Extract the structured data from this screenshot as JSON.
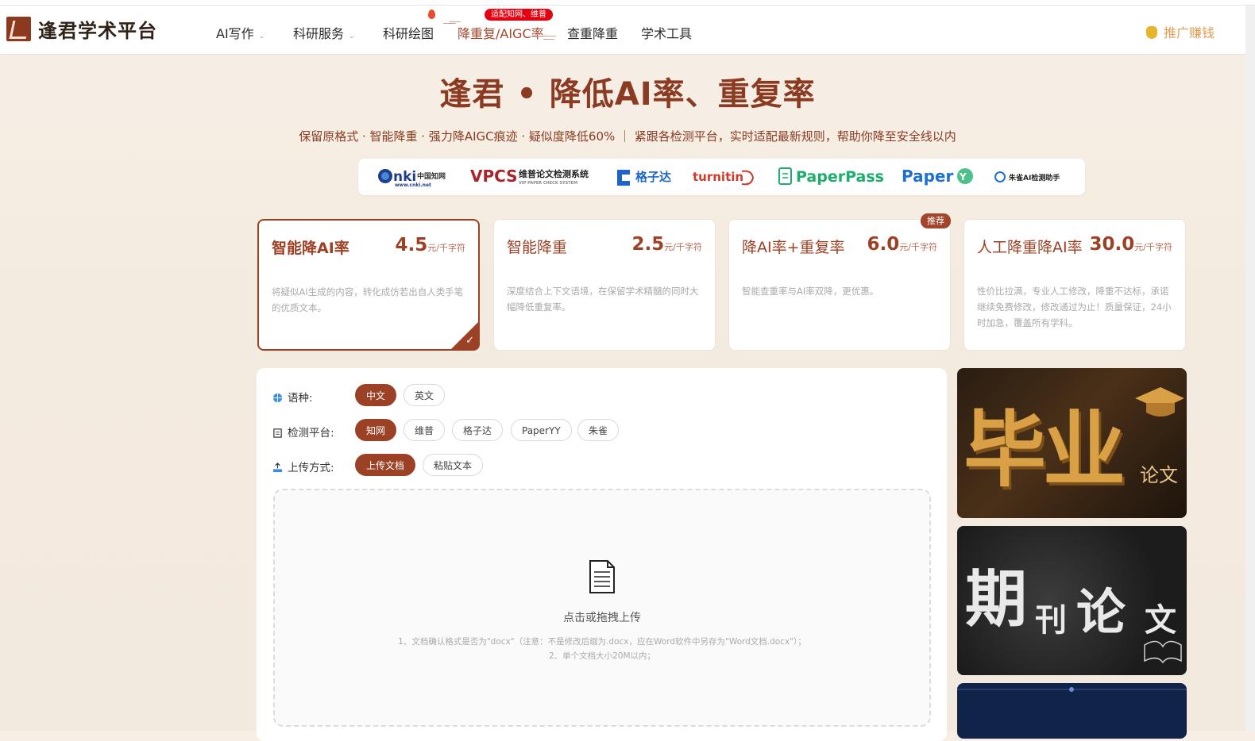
{
  "header": {
    "brand": "逢君学术平台",
    "nav": [
      {
        "label": "AI写作",
        "has_caret": true
      },
      {
        "label": "科研服务",
        "has_caret": true
      },
      {
        "label": "科研绘图",
        "has_caret": false
      },
      {
        "label": "降重复/AIGC率",
        "has_caret": false,
        "active": true
      },
      {
        "label": "查重降重",
        "has_caret": false
      },
      {
        "label": "学术工具",
        "has_caret": false
      }
    ],
    "hot_badge": "适配知网、维普",
    "promo": "推广赚钱",
    "icons": {
      "logo": "logo-icon",
      "fire": "fire-icon",
      "promo": "moneybag-icon"
    }
  },
  "hero": {
    "title": "逢君 • 降低AI率、重复率",
    "subtitle": "保留原格式 · 智能降重 · 强力降AIGC痕迹 · 疑似度降低60% ｜ 紧跟各检测平台，实时适配最新规则，帮助你降至安全线以内"
  },
  "platform_logos": [
    "CNKI中国知网 www.cnki.net",
    "VPCS 维普论文检测系统 VIP PAPER CHECK SYSTEM",
    "格子达",
    "turnitin",
    "PaperPass",
    "PaperYY",
    "朱雀AI检测助手"
  ],
  "cards": [
    {
      "title": "智能降AI率",
      "price": "4.5",
      "unit": "元/千字符",
      "desc": "将疑似AI生成的内容，转化成仿若出自人类手笔的优质文本。",
      "selected": true
    },
    {
      "title": "智能降重",
      "price": "2.5",
      "unit": "元/千字符",
      "desc": "深度结合上下文语境，在保留学术精髓的同时大幅降低重复率。",
      "selected": false
    },
    {
      "title": "降AI率+重复率",
      "price": "6.0",
      "unit": "元/千字符",
      "desc": "智能查重率与AI率双降，更优惠。",
      "selected": false,
      "badge": "推荐"
    },
    {
      "title": "人工降重降AI率",
      "price": "30.0",
      "unit": "元/千字符",
      "desc": "性价比拉满，专业人工修改，降重不达标，承诺继续免费修改，修改通过为止！质量保证，24小时加急，覆盖所有学科。",
      "selected": false
    }
  ],
  "form": {
    "language": {
      "label": "语种:",
      "options": [
        "中文",
        "英文"
      ],
      "selected": "中文"
    },
    "platform": {
      "label": "检测平台:",
      "options": [
        "知网",
        "维普",
        "格子达",
        "PaperYY",
        "朱雀"
      ],
      "selected": "知网"
    },
    "upload": {
      "label": "上传方式:",
      "options": [
        "上传文档",
        "粘贴文本"
      ],
      "selected": "上传文档"
    },
    "dropzone": {
      "title": "点击或拖拽上传",
      "note1": "1、文档确认格式是否为\"docx\"（注意：不是修改后缀为.docx，应在Word软件中另存为\"Word文档.docx\"）；",
      "note2": "2、单个文档大小20M以内；"
    }
  },
  "ads": [
    {
      "big": "毕业",
      "small": "论文"
    },
    {
      "big": "期",
      "mid1": "刊",
      "mid2": "论",
      "mid3": "文"
    }
  ],
  "colors": {
    "brand": "#9c4125",
    "hot": "#e60012",
    "promo": "#e29c56"
  }
}
